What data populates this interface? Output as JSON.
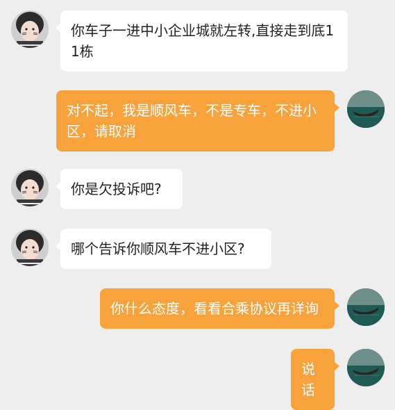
{
  "colors": {
    "background": "#eeeeee",
    "incoming_bubble": "#ffffff",
    "outgoing_bubble": "#f7a23b",
    "outgoing_text": "#ffffff",
    "incoming_text": "#222222"
  },
  "participants": {
    "other": {
      "avatar_icon": "girl-with-cat-whiskers-avatar-icon"
    },
    "self": {
      "avatar_icon": "boat-on-water-avatar-icon"
    }
  },
  "messages": [
    {
      "sender": "other",
      "text": "你车子一进中小企业城就左转,直接走到底11栋"
    },
    {
      "sender": "self",
      "text": "对不起，我是顺风车，不是专车，不进小区，请取消"
    },
    {
      "sender": "other",
      "text": "你是欠投诉吧?"
    },
    {
      "sender": "other",
      "text": "哪个告诉你顺风车不进小区?"
    },
    {
      "sender": "self",
      "text": "你什么态度，看看合乘协议再详询"
    },
    {
      "sender": "self",
      "text": "说话"
    }
  ]
}
